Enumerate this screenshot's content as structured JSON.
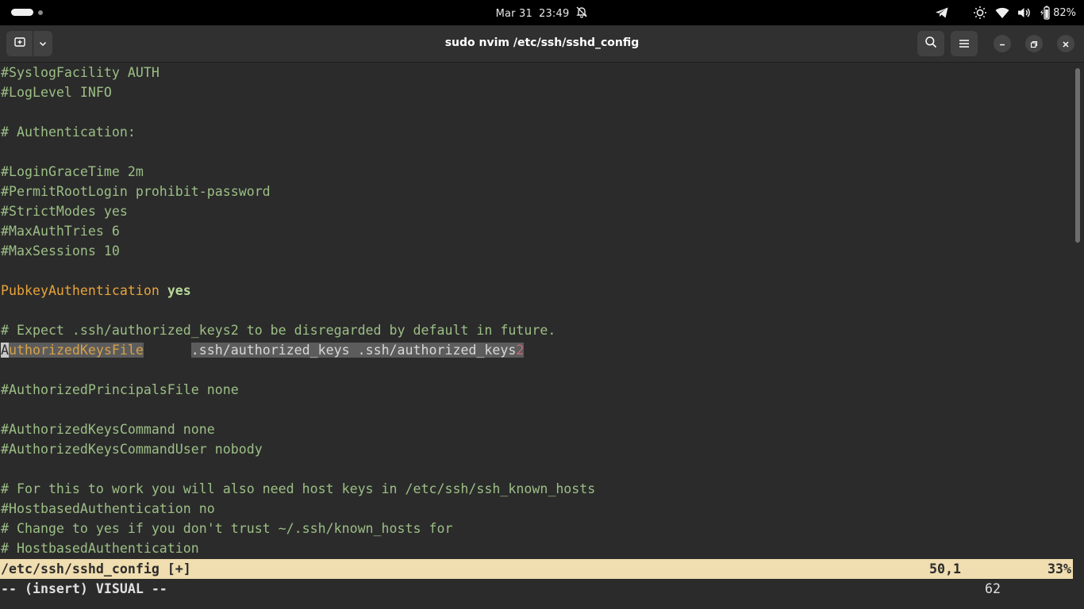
{
  "topbar": {
    "date": "Mar 31",
    "time": "23:49",
    "battery_percent": "82%",
    "icons": [
      "activities-indicator",
      "notifications-muted-icon",
      "telegram-icon",
      "brightness-icon",
      "wifi-icon",
      "volume-icon",
      "battery-icon"
    ]
  },
  "window": {
    "title": "sudo nvim /etc/ssh/sshd_config",
    "buttons": [
      "new-tab-icon",
      "chevron-down-icon",
      "search-icon",
      "hamburger-menu-icon",
      "minimize-icon",
      "restore-icon",
      "close-icon"
    ]
  },
  "editor": {
    "lines": [
      "#SyslogFacility AUTH",
      "#LogLevel INFO",
      "",
      "# Authentication:",
      "",
      "#LoginGraceTime 2m",
      "#PermitRootLogin prohibit-password",
      "#StrictModes yes",
      "#MaxAuthTries 6",
      "#MaxSessions 10",
      "",
      "",
      "",
      "# Expect .ssh/authorized_keys2 to be disregarded by default in future.",
      "",
      "",
      "#AuthorizedPrincipalsFile none",
      "",
      "#AuthorizedKeysCommand none",
      "#AuthorizedKeysCommandUser nobody",
      "",
      "# For this to work you will also need host keys in /etc/ssh/ssh_known_hosts",
      "#HostbasedAuthentication no",
      "# Change to yes if you don't trust ~/.ssh/known_hosts for",
      "# HostbasedAuthentication"
    ],
    "pubkey_line": {
      "keyword": "PubkeyAuthentication",
      "value": "yes"
    },
    "selected_line": {
      "cursor_char": "A",
      "keyword_rest": "uthorizedKeysFile",
      "gap": "      ",
      "paths": ".ssh/authorized_keys .ssh/authorized_keys",
      "last_char": "2"
    }
  },
  "statusline": {
    "filename": "/etc/ssh/sshd_config [+]",
    "position": "50,1",
    "percent": "33%"
  },
  "cmdline": {
    "mode": "-- (insert) VISUAL --",
    "count": "62"
  },
  "colors": {
    "background": "#2b2b2b",
    "comment": "#9cbf86",
    "keyword": "#e8a33a",
    "statusline_bg": "#f0ddb0",
    "selection_bg": "#5c5c5c"
  }
}
